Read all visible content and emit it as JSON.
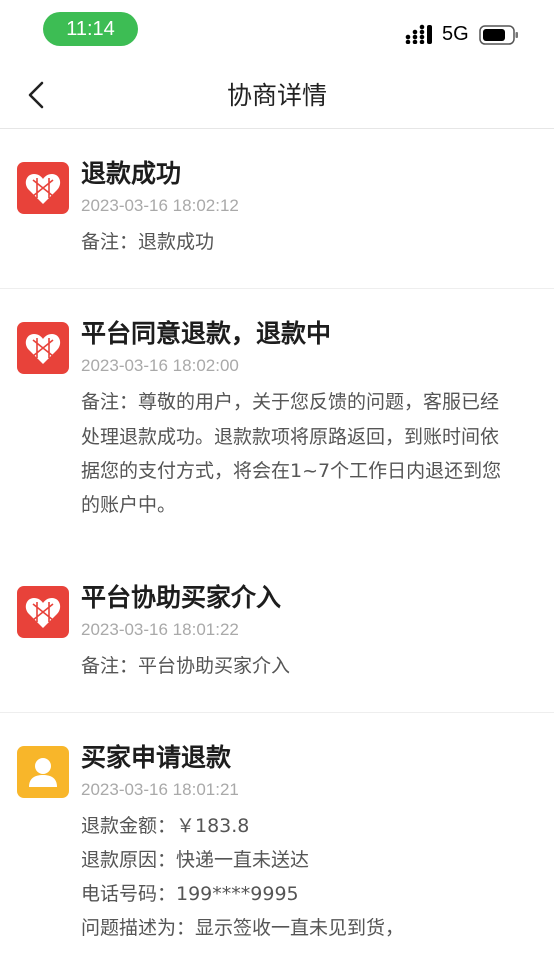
{
  "status": {
    "time": "11:14",
    "network": "5G"
  },
  "nav": {
    "title": "协商详情"
  },
  "records": [
    {
      "title": "退款成功",
      "time": "2023-03-16 18:02:12",
      "lines": [
        "备注：退款成功"
      ]
    },
    {
      "title": "平台同意退款，退款中",
      "time": "2023-03-16 18:02:00",
      "lines": [
        "备注：尊敬的用户，关于您反馈的问题，客服已经",
        "处理退款成功。退款款项将原路返回，到账时间依",
        "据您的支付方式，将会在1~7个工作日内退还到您",
        "的账户中。"
      ]
    },
    {
      "title": "平台协助买家介入",
      "time": "2023-03-16 18:01:22",
      "lines": [
        "备注：平台协助买家介入"
      ]
    },
    {
      "title": "买家申请退款",
      "time": "2023-03-16 18:01:21",
      "lines": [
        "退款金额：￥183.8",
        "退款原因：快递一直未送达",
        "电话号码：199****9995",
        "问题描述为：显示签收一直未见到货，"
      ]
    }
  ],
  "colors": {
    "brand_red": "#e8423a",
    "buyer_yellow": "#f8b62a",
    "time_pill": "#3dbd54"
  },
  "icons": {
    "back": "chevron-left-icon",
    "merchant_logo": "pinduoduo-logo-icon",
    "buyer_avatar": "user-icon",
    "signal": "signal-icon",
    "battery": "battery-icon"
  }
}
